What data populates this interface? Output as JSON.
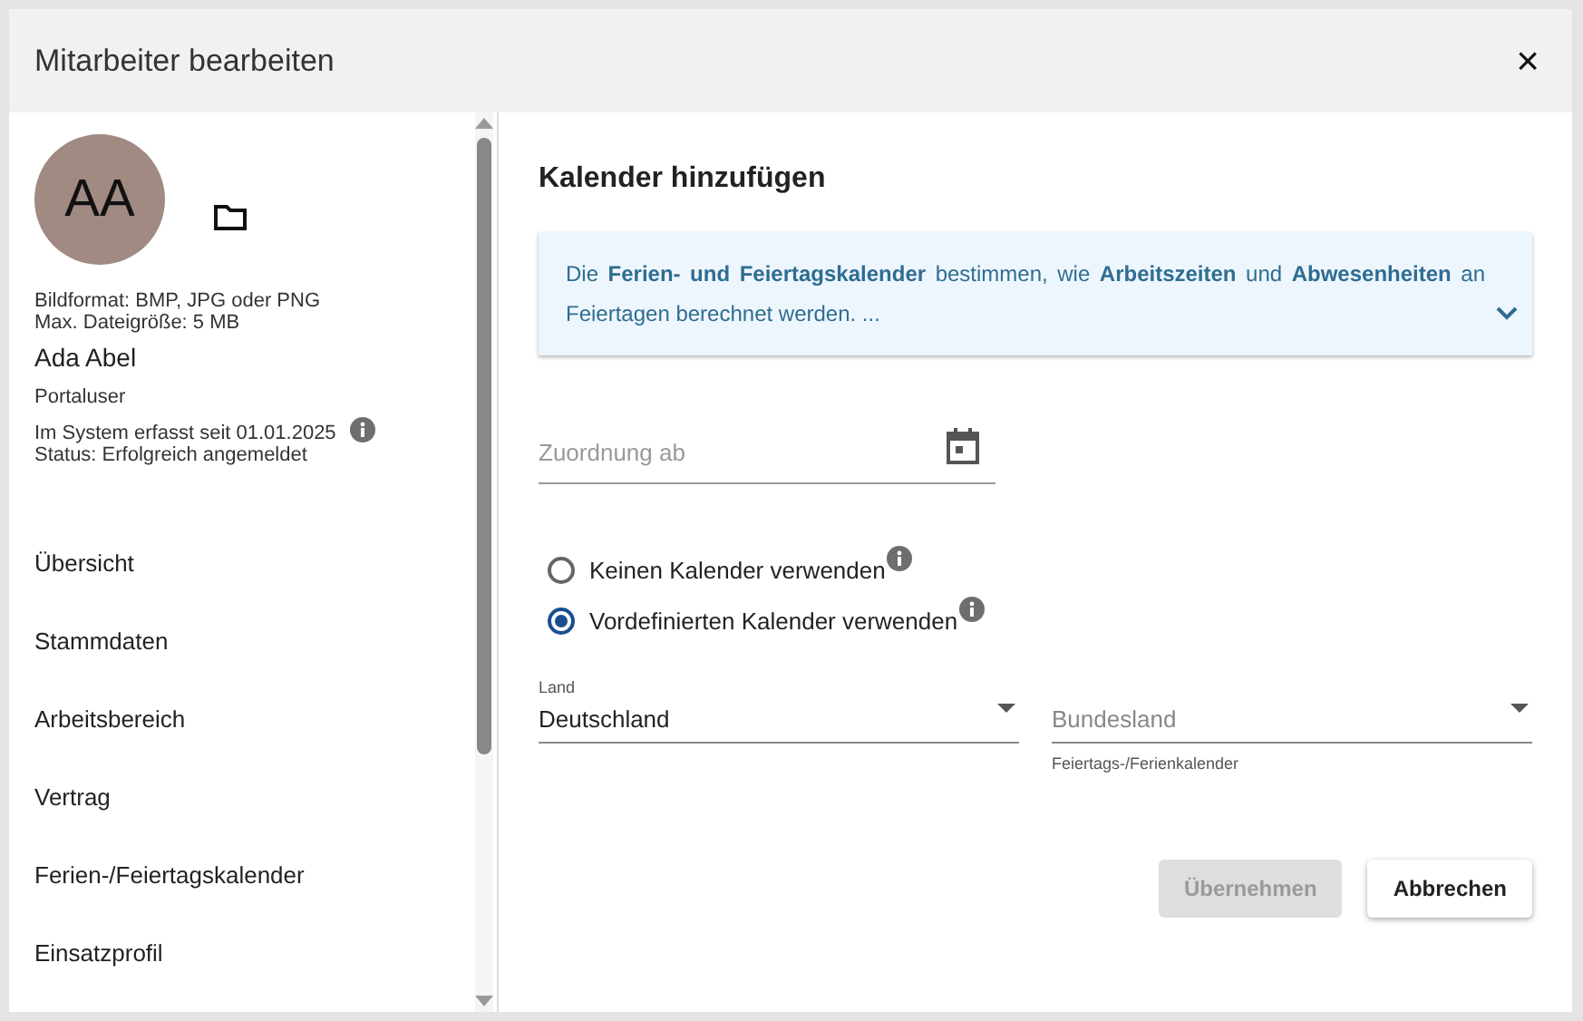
{
  "dialog": {
    "title": "Mitarbeiter bearbeiten",
    "close": "×"
  },
  "profile": {
    "initials": "AA",
    "image_hint": [
      "Bildformat: BMP, JPG oder PNG",
      "Max. Dateigröße: 5 MB"
    ],
    "name": "Ada Abel",
    "role": "Portaluser",
    "registered": "Im System erfasst seit 01.01.2025",
    "status": "Status: Erfolgreich angemeldet"
  },
  "sidebar": {
    "items": [
      {
        "label": "Übersicht",
        "selected": false
      },
      {
        "label": "Stammdaten",
        "selected": false
      },
      {
        "label": "Arbeitsbereich",
        "selected": false
      },
      {
        "label": "Vertrag",
        "selected": false
      },
      {
        "label": "Ferien-/Feiertagskalender",
        "selected": false
      },
      {
        "label": "Einsatzprofil",
        "selected": false
      }
    ]
  },
  "content": {
    "heading": "Kalender hinzufügen",
    "info": "Die **Ferien- und Feiertagskalender** bestimmen, wie **Arbeitszeiten** und **Abwesenheiten** an Feiertagen berechnet werden. ...",
    "date_field": {
      "placeholder": "Zuordnung ab"
    },
    "options": [
      {
        "label": "Keinen Kalender verwenden",
        "selected": false
      },
      {
        "label": "Vordefinierten Kalender verwenden",
        "selected": true
      }
    ],
    "country": {
      "label": "Land",
      "value": "Deutschland"
    },
    "state": {
      "placeholder": "Bundesland",
      "hint": "Feiertags-/Ferienkalender"
    },
    "buttons": [
      {
        "label": "Übernehmen",
        "disabled": true
      },
      {
        "label": "Abbrechen",
        "disabled": false
      }
    ]
  }
}
